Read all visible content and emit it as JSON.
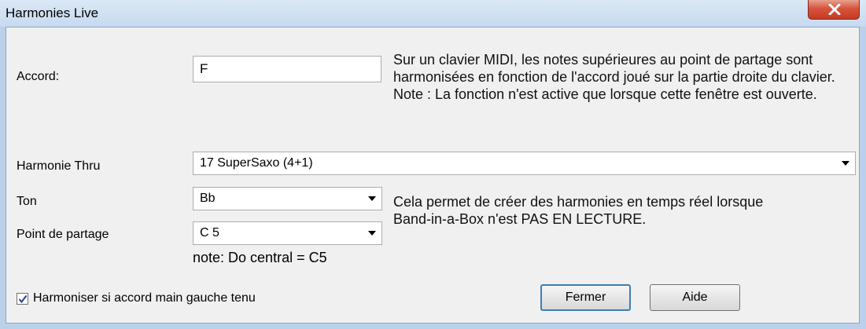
{
  "window": {
    "title": "Harmonies Live"
  },
  "chord": {
    "label": "Accord:",
    "value": "F"
  },
  "description1": "Sur un clavier MIDI, les notes supérieures au point de partage sont harmonisées en fonction de l'accord joué sur la partie droite du clavier.  Note : La fonction n'est active que lorsque cette fenêtre est ouverte.",
  "harmony_thru": {
    "label": "Harmonie Thru",
    "value": "17 SuperSaxo (4+1)"
  },
  "key": {
    "label": "Ton",
    "value": "Bb"
  },
  "split_point": {
    "label": "Point de partage",
    "value": "C 5"
  },
  "description2": "Cela permet de créer des harmonies en temps réel lorsque Band-in-a-Box n'est PAS EN LECTURE.",
  "note": "note: Do central = C5",
  "checkbox": {
    "label": "Harmoniser si accord main gauche tenu",
    "checked": true
  },
  "buttons": {
    "close": "Fermer",
    "help": "Aide"
  }
}
